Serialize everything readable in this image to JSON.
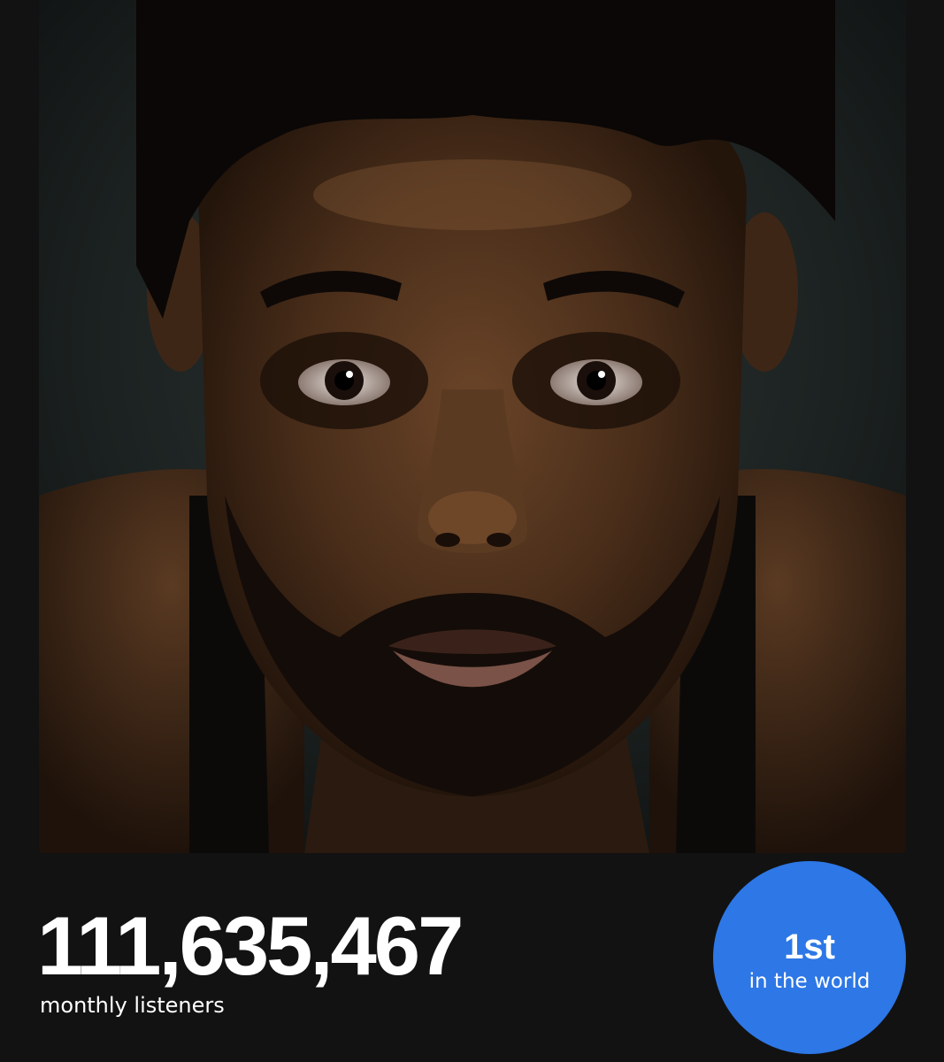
{
  "artist_photo": {
    "alt": "artist portrait"
  },
  "stats": {
    "monthly_listeners": "111,635,467",
    "monthly_listeners_label": "monthly listeners"
  },
  "rank": {
    "value": "1st",
    "label": "in the world"
  },
  "colors": {
    "background": "#121212",
    "rank_badge": "#2d77e6",
    "text": "#ffffff"
  }
}
